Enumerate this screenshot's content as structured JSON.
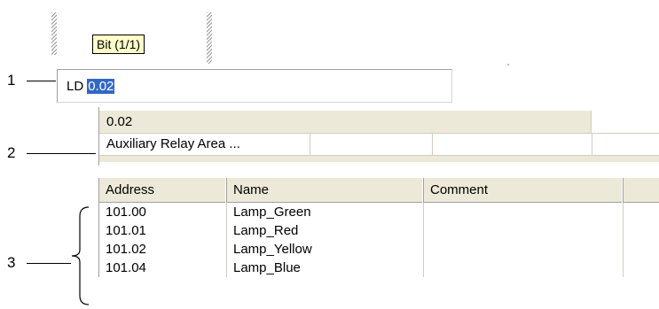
{
  "tooltip": {
    "text": "Bit (1/1)"
  },
  "callouts": {
    "one": "1",
    "two": "2",
    "three": "3"
  },
  "command": {
    "mnemonic": "LD",
    "operand": "0.02"
  },
  "info": {
    "address": "0.02",
    "area": "Auxiliary Relay Area ..."
  },
  "table": {
    "headers": {
      "address": "Address",
      "name": "Name",
      "comment": "Comment"
    },
    "rows": [
      {
        "address": "101.00",
        "name": "Lamp_Green",
        "comment": ""
      },
      {
        "address": "101.01",
        "name": "Lamp_Red",
        "comment": ""
      },
      {
        "address": "101.02",
        "name": "Lamp_Yellow",
        "comment": ""
      },
      {
        "address": "101.04",
        "name": "Lamp_Blue",
        "comment": ""
      }
    ]
  }
}
